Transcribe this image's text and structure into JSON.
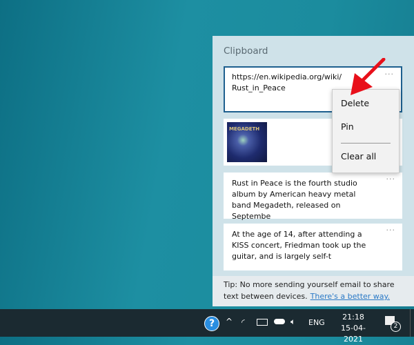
{
  "clipboard": {
    "title": "Clipboard",
    "items": [
      {
        "text": "https://en.wikipedia.org/wiki/ Rust_in_Peace"
      },
      {
        "image_label": "MEGADETH"
      },
      {
        "text": "Rust in Peace is the fourth studio album by American heavy metal band Megadeth, released on Septembe"
      },
      {
        "text": "At the age of 14, after attending a KISS concert, Friedman took up the guitar, and is largely self-t"
      }
    ],
    "more_label": "···",
    "tip": "Tip: No more sending yourself email to share text between devices.",
    "tip_link": "There's a better way."
  },
  "context_menu": {
    "items": [
      "Delete",
      "Pin",
      "Clear all"
    ]
  },
  "taskbar": {
    "language": "ENG",
    "time": "21:18",
    "date": "15-04-2021",
    "notification_count": "2"
  }
}
